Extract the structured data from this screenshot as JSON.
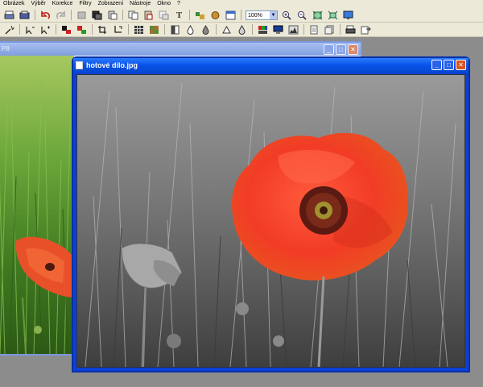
{
  "menu": [
    "Obrázek",
    "Výběr",
    "Korekce",
    "Filtry",
    "Zobrazení",
    "Nástroje",
    "Okno",
    "?"
  ],
  "toolbar": {
    "zoom_value": "100%",
    "text_tool_glyph": "T"
  },
  "windows": {
    "back": {
      "title": "P8"
    },
    "front": {
      "title": "hotové dílo.jpg"
    }
  },
  "colors": {
    "poppy_red": "#f03a28",
    "poppy_center": "#6b1a10",
    "grass_gray": "#7a7a7a",
    "title_blue": "#0a52e8"
  }
}
